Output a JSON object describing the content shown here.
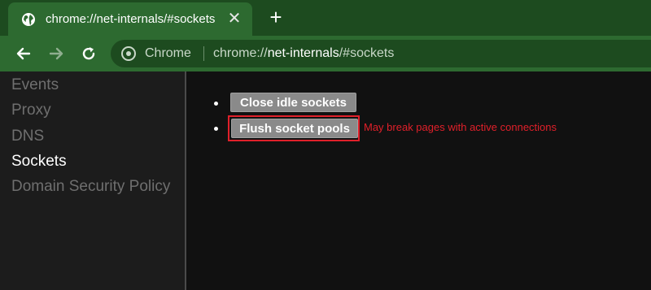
{
  "tab": {
    "title": "chrome://net-internals/#sockets",
    "close_glyph": "✕",
    "icon": "globe-icon"
  },
  "new_tab_glyph": "+",
  "omnibox": {
    "site_label": "Chrome",
    "url_scheme": "chrome://",
    "url_host": "net-internals",
    "url_path": "/#sockets"
  },
  "sidebar": {
    "items": [
      {
        "label": "Events",
        "active": false
      },
      {
        "label": "Proxy",
        "active": false
      },
      {
        "label": "DNS",
        "active": false
      },
      {
        "label": "Sockets",
        "active": true
      },
      {
        "label": "Domain Security Policy",
        "active": false
      }
    ]
  },
  "content": {
    "close_idle_label": "Close idle sockets",
    "flush_label": "Flush socket pools",
    "flush_warning": "May break pages with active connections"
  },
  "colors": {
    "accent_frame": "#2d6a30",
    "highlight_red": "#e0202a"
  }
}
